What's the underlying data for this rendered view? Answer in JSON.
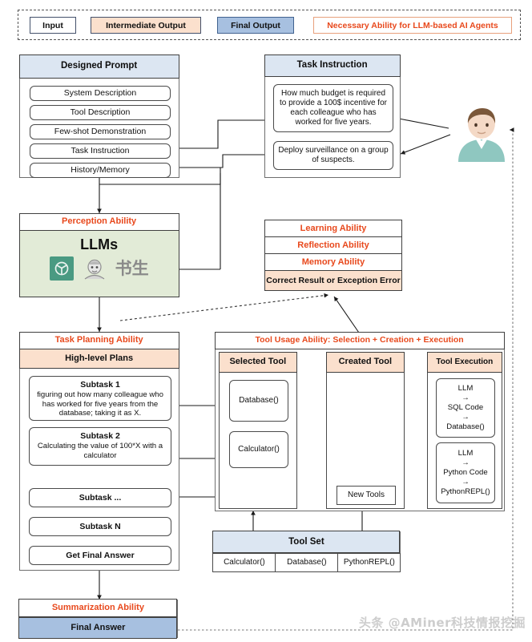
{
  "legend": {
    "items": [
      {
        "label": "Input",
        "color": "#ffffff"
      },
      {
        "label": "Intermediate Output",
        "color": "#fbe0cd"
      },
      {
        "label": "Final Output",
        "color": "#a7c0e0"
      },
      {
        "label": "Necessary Ability for LLM-based AI Agents",
        "color": "#ffffff"
      }
    ]
  },
  "designed_prompt": {
    "title": "Designed Prompt",
    "items": [
      "System Description",
      "Tool Description",
      "Few-shot Demonstration",
      "Task Instruction",
      "History/Memory"
    ]
  },
  "task_instruction": {
    "title": "Task Instruction",
    "items": [
      "How much budget is required to provide a 100$ incentive for each colleague who has worked for five years.",
      "Deploy surveillance on a group of suspects."
    ]
  },
  "perception": {
    "title": "Perception Ability",
    "model_label": "LLMs",
    "logos": [
      "openai-logo",
      "shusheng-internlm-logo"
    ]
  },
  "abilities_panel": {
    "items": [
      "Learning Ability",
      "Reflection Ability",
      "Memory Ability"
    ],
    "result": "Correct Result or Exception Error"
  },
  "task_planning": {
    "title": "Task Planning Ability",
    "subtitle": "High-level Plans",
    "subtasks": [
      {
        "title": "Subtask 1",
        "body": "figuring out how many colleague who has worked for five years from the database; taking it as X."
      },
      {
        "title": "Subtask 2",
        "body": "Calculating the value of 100*X with a calculator"
      },
      {
        "title": "Subtask ...",
        "body": ""
      },
      {
        "title": "Subtask N",
        "body": ""
      },
      {
        "title": "Get Final Answer",
        "body": ""
      }
    ]
  },
  "tool_usage": {
    "title": "Tool Usage Ability: Selection + Creation + Execution",
    "columns": [
      {
        "header": "Selected Tool",
        "items": [
          "Database()",
          "Calculator()"
        ]
      },
      {
        "header": "Created Tool",
        "items": [
          "New Tools"
        ]
      },
      {
        "header": "Tool Execution",
        "items": [
          "LLM\n→\nSQL Code\n→\nDatabase()",
          "LLM\n→\nPython Code\n→\nPythonREPL()"
        ]
      }
    ]
  },
  "tool_set": {
    "title": "Tool Set",
    "tools": [
      "Calculator()",
      "Database()",
      "PythonREPL()"
    ]
  },
  "summarization": {
    "title": "Summarization Ability",
    "final_answer": "Final Answer"
  },
  "watermark": "头条 @AMiner科技情报挖掘",
  "colors": {
    "accent_red": "#e8491d",
    "header_blue": "#dce6f2",
    "header_peach": "#fbe0cd",
    "final_blue": "#a7c0e0",
    "llm_green": "#e2ebd7",
    "border_gray": "#404040"
  }
}
